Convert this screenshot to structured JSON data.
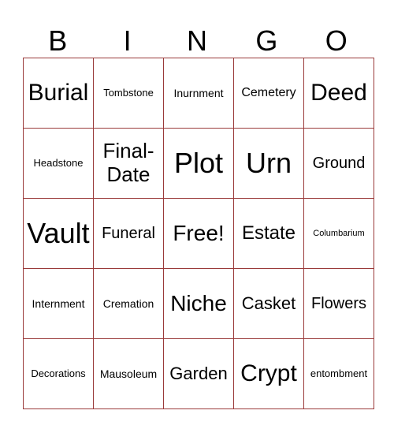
{
  "header": {
    "letters": [
      "B",
      "I",
      "N",
      "G",
      "O"
    ]
  },
  "grid": {
    "rows": [
      [
        "Burial",
        "Tombstone",
        "Inurnment",
        "Cemetery",
        "Deed"
      ],
      [
        "Headstone",
        "Final-Date",
        "Plot",
        "Urn",
        "Ground"
      ],
      [
        "Vault",
        "Funeral",
        "Free!",
        "Estate",
        "Columbarium"
      ],
      [
        "Internment",
        "Cremation",
        "Niche",
        "Casket",
        "Flowers"
      ],
      [
        "Decorations",
        "Mausoleum",
        "Garden",
        "Crypt",
        "entombment"
      ]
    ]
  },
  "colors": {
    "border": "#9a3a3a",
    "free_text": "#9b2226"
  }
}
